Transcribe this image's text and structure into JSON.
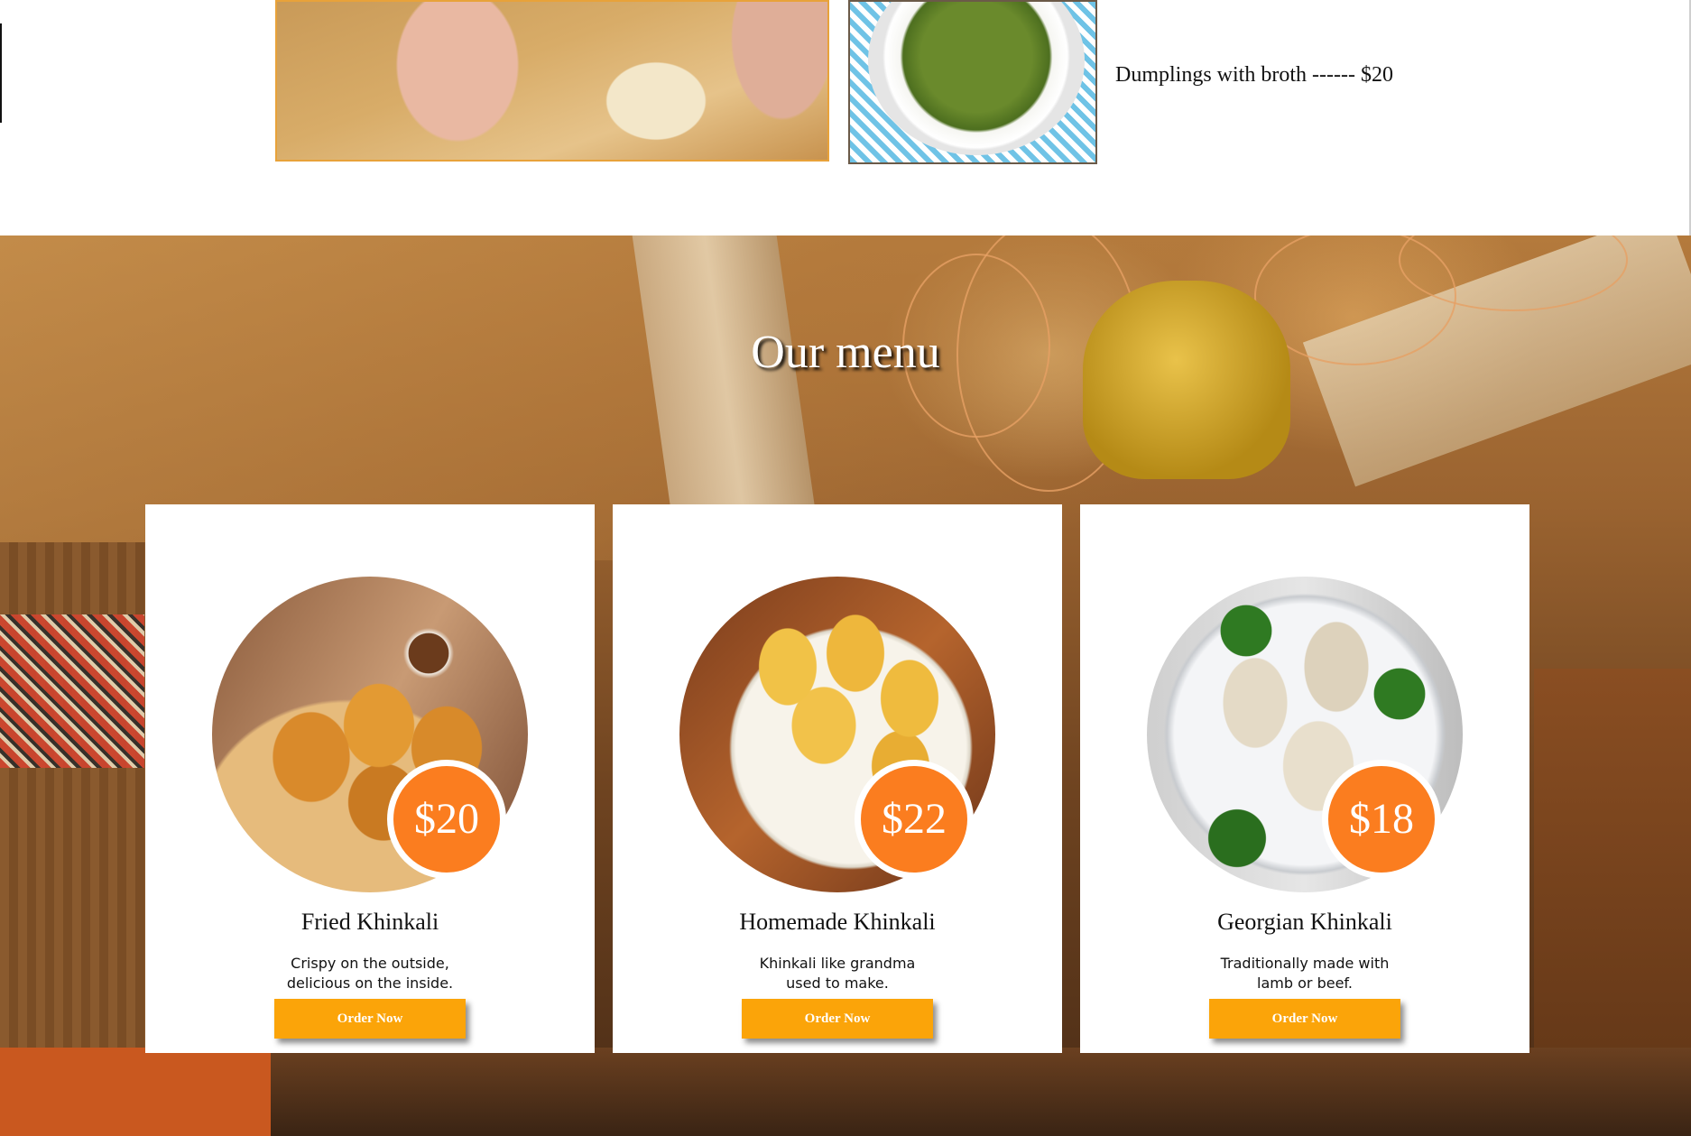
{
  "top_section": {
    "caption": "Dumplings with broth ------ $20"
  },
  "menu": {
    "title": "Our menu",
    "items": [
      {
        "name": "Fried Khinkali",
        "price": "$20",
        "description": "Crispy on the outside, delicious on the inside.",
        "button": "Order Now"
      },
      {
        "name": "Homemade Khinkali",
        "price": "$22",
        "description": "Khinkali like grandma used to make.",
        "button": "Order Now"
      },
      {
        "name": "Georgian Khinkali",
        "price": "$18",
        "description": "Traditionally made with lamb or beef.",
        "button": "Order Now"
      }
    ]
  },
  "colors": {
    "accent_orange": "#fb7d1f",
    "button_orange": "#fba409",
    "image_border": "#e8a23a"
  }
}
